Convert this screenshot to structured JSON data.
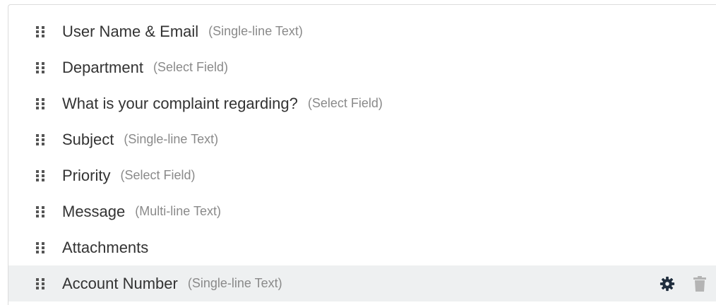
{
  "fields": [
    {
      "label": "User Name & Email",
      "type": "(Single-line Text)"
    },
    {
      "label": "Department",
      "type": "(Select Field)"
    },
    {
      "label": "What is your complaint regarding?",
      "type": "(Select Field)"
    },
    {
      "label": "Subject",
      "type": "(Single-line Text)"
    },
    {
      "label": "Priority",
      "type": "(Select Field)"
    },
    {
      "label": "Message",
      "type": "(Multi-line Text)"
    },
    {
      "label": "Attachments",
      "type": ""
    },
    {
      "label": "Account Number",
      "type": "(Single-line Text)"
    }
  ],
  "selected_index": 7,
  "icons": {
    "handle": "drag-handle-icon",
    "settings": "gear-icon",
    "delete": "trash-icon"
  },
  "colors": {
    "label": "#333333",
    "type": "#8a8a8a",
    "handle": "#555555",
    "selected_bg": "#eef0f1",
    "gear": "#1f2d3d",
    "trash": "#b4b4b4"
  }
}
